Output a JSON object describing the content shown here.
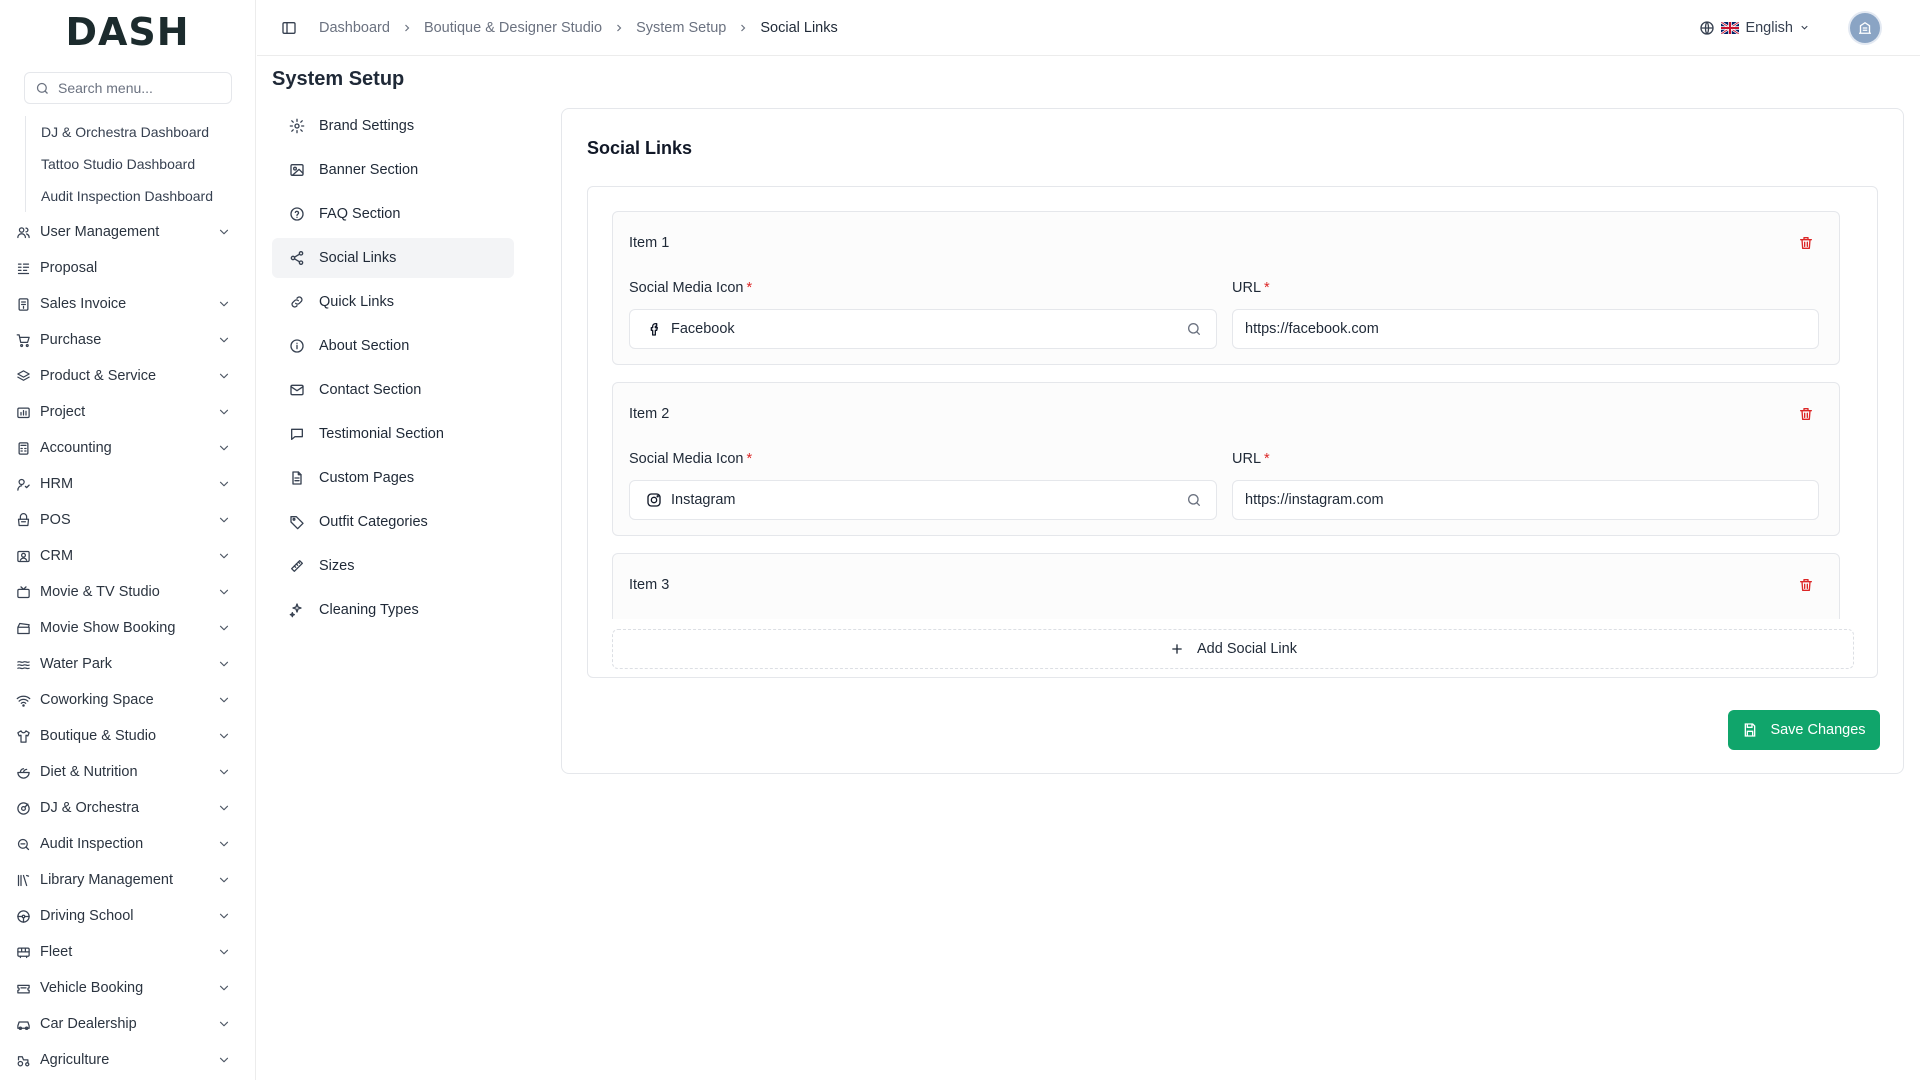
{
  "brand": {
    "logo_text": "DASH",
    "accent_color": "#10b981"
  },
  "sidebar": {
    "search_placeholder": "Search menu...",
    "submenu": [
      "DJ & Orchestra Dashboard",
      "Tattoo Studio Dashboard",
      "Audit Inspection Dashboard"
    ],
    "items": [
      {
        "label": "User Management",
        "icon": "users-icon",
        "has_children": true
      },
      {
        "label": "Proposal",
        "icon": "proposal-icon",
        "has_children": false
      },
      {
        "label": "Sales Invoice",
        "icon": "invoice-icon",
        "has_children": true
      },
      {
        "label": "Purchase",
        "icon": "cart-icon",
        "has_children": true
      },
      {
        "label": "Product & Service",
        "icon": "layers-icon",
        "has_children": true
      },
      {
        "label": "Project",
        "icon": "project-icon",
        "has_children": true
      },
      {
        "label": "Accounting",
        "icon": "calculator-icon",
        "has_children": true
      },
      {
        "label": "HRM",
        "icon": "hrm-icon",
        "has_children": true
      },
      {
        "label": "POS",
        "icon": "pos-icon",
        "has_children": true
      },
      {
        "label": "CRM",
        "icon": "crm-icon",
        "has_children": true
      },
      {
        "label": "Movie & TV Studio",
        "icon": "tv-icon",
        "has_children": true
      },
      {
        "label": "Movie Show Booking",
        "icon": "clapper-icon",
        "has_children": true
      },
      {
        "label": "Water Park",
        "icon": "waves-icon",
        "has_children": true
      },
      {
        "label": "Coworking Space",
        "icon": "wifi-icon",
        "has_children": true
      },
      {
        "label": "Boutique & Studio",
        "icon": "shirt-icon",
        "has_children": true
      },
      {
        "label": "Diet & Nutrition",
        "icon": "salad-icon",
        "has_children": true
      },
      {
        "label": "DJ & Orchestra",
        "icon": "disc-icon",
        "has_children": true
      },
      {
        "label": "Audit Inspection",
        "icon": "magnifier-icon",
        "has_children": true
      },
      {
        "label": "Library Management",
        "icon": "library-icon",
        "has_children": true
      },
      {
        "label": "Driving School",
        "icon": "steering-icon",
        "has_children": true
      },
      {
        "label": "Fleet",
        "icon": "bus-icon",
        "has_children": true
      },
      {
        "label": "Vehicle Booking",
        "icon": "ticket-icon",
        "has_children": true
      },
      {
        "label": "Car Dealership",
        "icon": "car-icon",
        "has_children": true
      },
      {
        "label": "Agriculture",
        "icon": "tractor-icon",
        "has_children": true
      }
    ]
  },
  "header": {
    "breadcrumbs": [
      "Dashboard",
      "Boutique & Designer Studio",
      "System Setup",
      "Social Links"
    ],
    "language": "English"
  },
  "page": {
    "title": "System Setup",
    "setup_nav": [
      {
        "label": "Brand Settings",
        "icon": "gear-icon",
        "active": false
      },
      {
        "label": "Banner Section",
        "icon": "image-icon",
        "active": false
      },
      {
        "label": "FAQ Section",
        "icon": "help-circle-icon",
        "active": false
      },
      {
        "label": "Social Links",
        "icon": "share-icon",
        "active": true
      },
      {
        "label": "Quick Links",
        "icon": "link-icon",
        "active": false
      },
      {
        "label": "About Section",
        "icon": "info-icon",
        "active": false
      },
      {
        "label": "Contact Section",
        "icon": "mail-icon",
        "active": false
      },
      {
        "label": "Testimonial Section",
        "icon": "chat-icon",
        "active": false
      },
      {
        "label": "Custom Pages",
        "icon": "file-icon",
        "active": false
      },
      {
        "label": "Outfit Categories",
        "icon": "tag-icon",
        "active": false
      },
      {
        "label": "Sizes",
        "icon": "ruler-icon",
        "active": false
      },
      {
        "label": "Cleaning Types",
        "icon": "sparkles-icon",
        "active": false
      }
    ]
  },
  "social_links": {
    "title": "Social Links",
    "icon_label": "Social Media Icon",
    "url_label": "URL",
    "required_mark": "*",
    "items": [
      {
        "title": "Item 1",
        "icon_name": "Facebook",
        "icon": "facebook-icon",
        "url": "https://facebook.com"
      },
      {
        "title": "Item 2",
        "icon_name": "Instagram",
        "icon": "instagram-icon",
        "url": "https://instagram.com"
      },
      {
        "title": "Item 3",
        "icon_name": "",
        "icon": "",
        "url": ""
      }
    ],
    "add_label": "Add Social Link",
    "save_label": "Save Changes",
    "save_color": "#10a56b"
  }
}
